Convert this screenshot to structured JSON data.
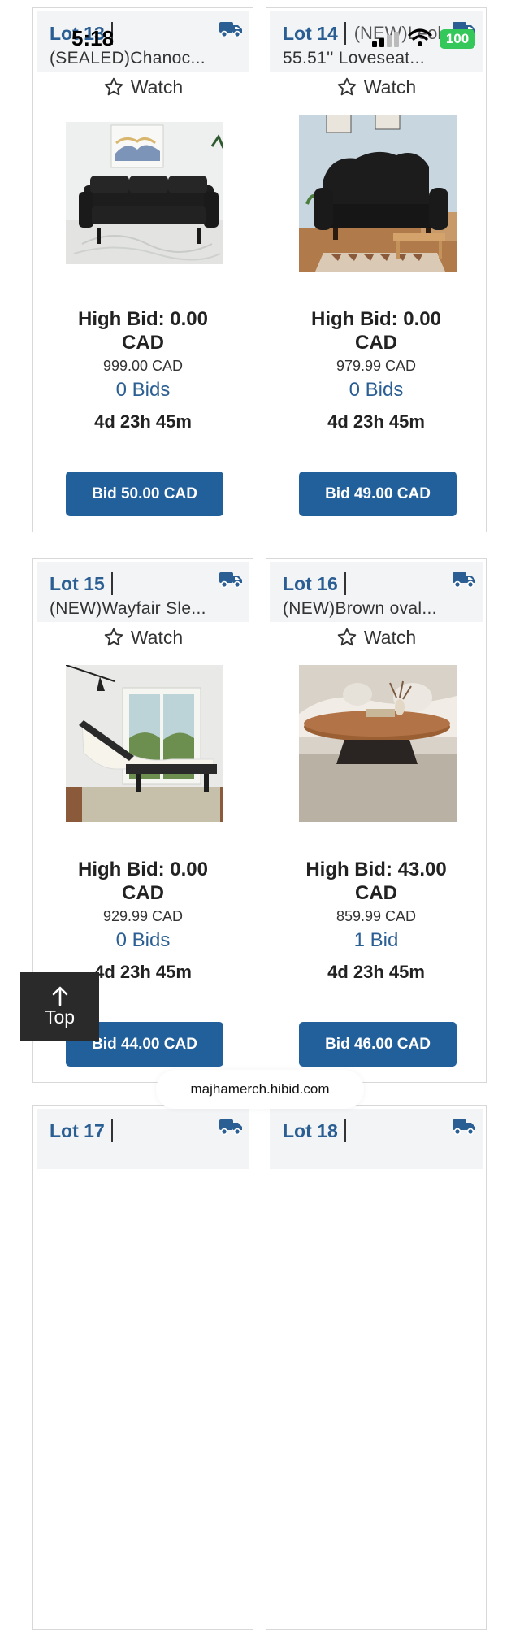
{
  "status_bar": {
    "time": "5:18",
    "battery": "100"
  },
  "lots": [
    {
      "lot": "Lot 13",
      "extra": "",
      "title": "(SEALED)Chanoc...",
      "watch": "Watch",
      "high_bid": "High Bid: 0.00 CAD",
      "price": "999.00 CAD",
      "bids": "0 Bids",
      "time_left": "4d 23h 45m",
      "button": "Bid 50.00 CAD"
    },
    {
      "lot": "Lot 14",
      "extra": "(NEW)Leola",
      "title": "55.51'' Loveseat...",
      "watch": "Watch",
      "high_bid": "High Bid: 0.00 CAD",
      "price": "979.99 CAD",
      "bids": "0 Bids",
      "time_left": "4d 23h 45m",
      "button": "Bid 49.00 CAD"
    },
    {
      "lot": "Lot 15",
      "extra": "",
      "title": "(NEW)Wayfair Sle...",
      "watch": "Watch",
      "high_bid": "High Bid: 0.00 CAD",
      "price": "929.99 CAD",
      "bids": "0 Bids",
      "time_left": "4d 23h 45m",
      "button": "Bid 44.00 CAD"
    },
    {
      "lot": "Lot 16",
      "extra": "",
      "title": "(NEW)Brown oval...",
      "watch": "Watch",
      "high_bid": "High Bid: 43.00 CAD",
      "price": "859.99 CAD",
      "bids": "1 Bid",
      "time_left": "4d 23h 45m",
      "button": "Bid 46.00 CAD"
    },
    {
      "lot": "Lot 17",
      "extra": "",
      "title": "",
      "watch": "",
      "high_bid": "",
      "price": "",
      "bids": "",
      "time_left": "",
      "button": ""
    },
    {
      "lot": "Lot 18",
      "extra": "",
      "title": "",
      "watch": "",
      "high_bid": "",
      "price": "",
      "bids": "",
      "time_left": "",
      "button": ""
    }
  ],
  "top_button": {
    "label": "Top"
  },
  "browser": {
    "url": "majhamerch.hibid.com"
  },
  "colors": {
    "accent": "#22609c",
    "lot_blue": "#2b5f93",
    "header_bg": "#f3f4f6"
  },
  "icons": {
    "truck": "truck-icon",
    "star": "star-outline-icon",
    "arrow": "arrow-up-icon"
  }
}
